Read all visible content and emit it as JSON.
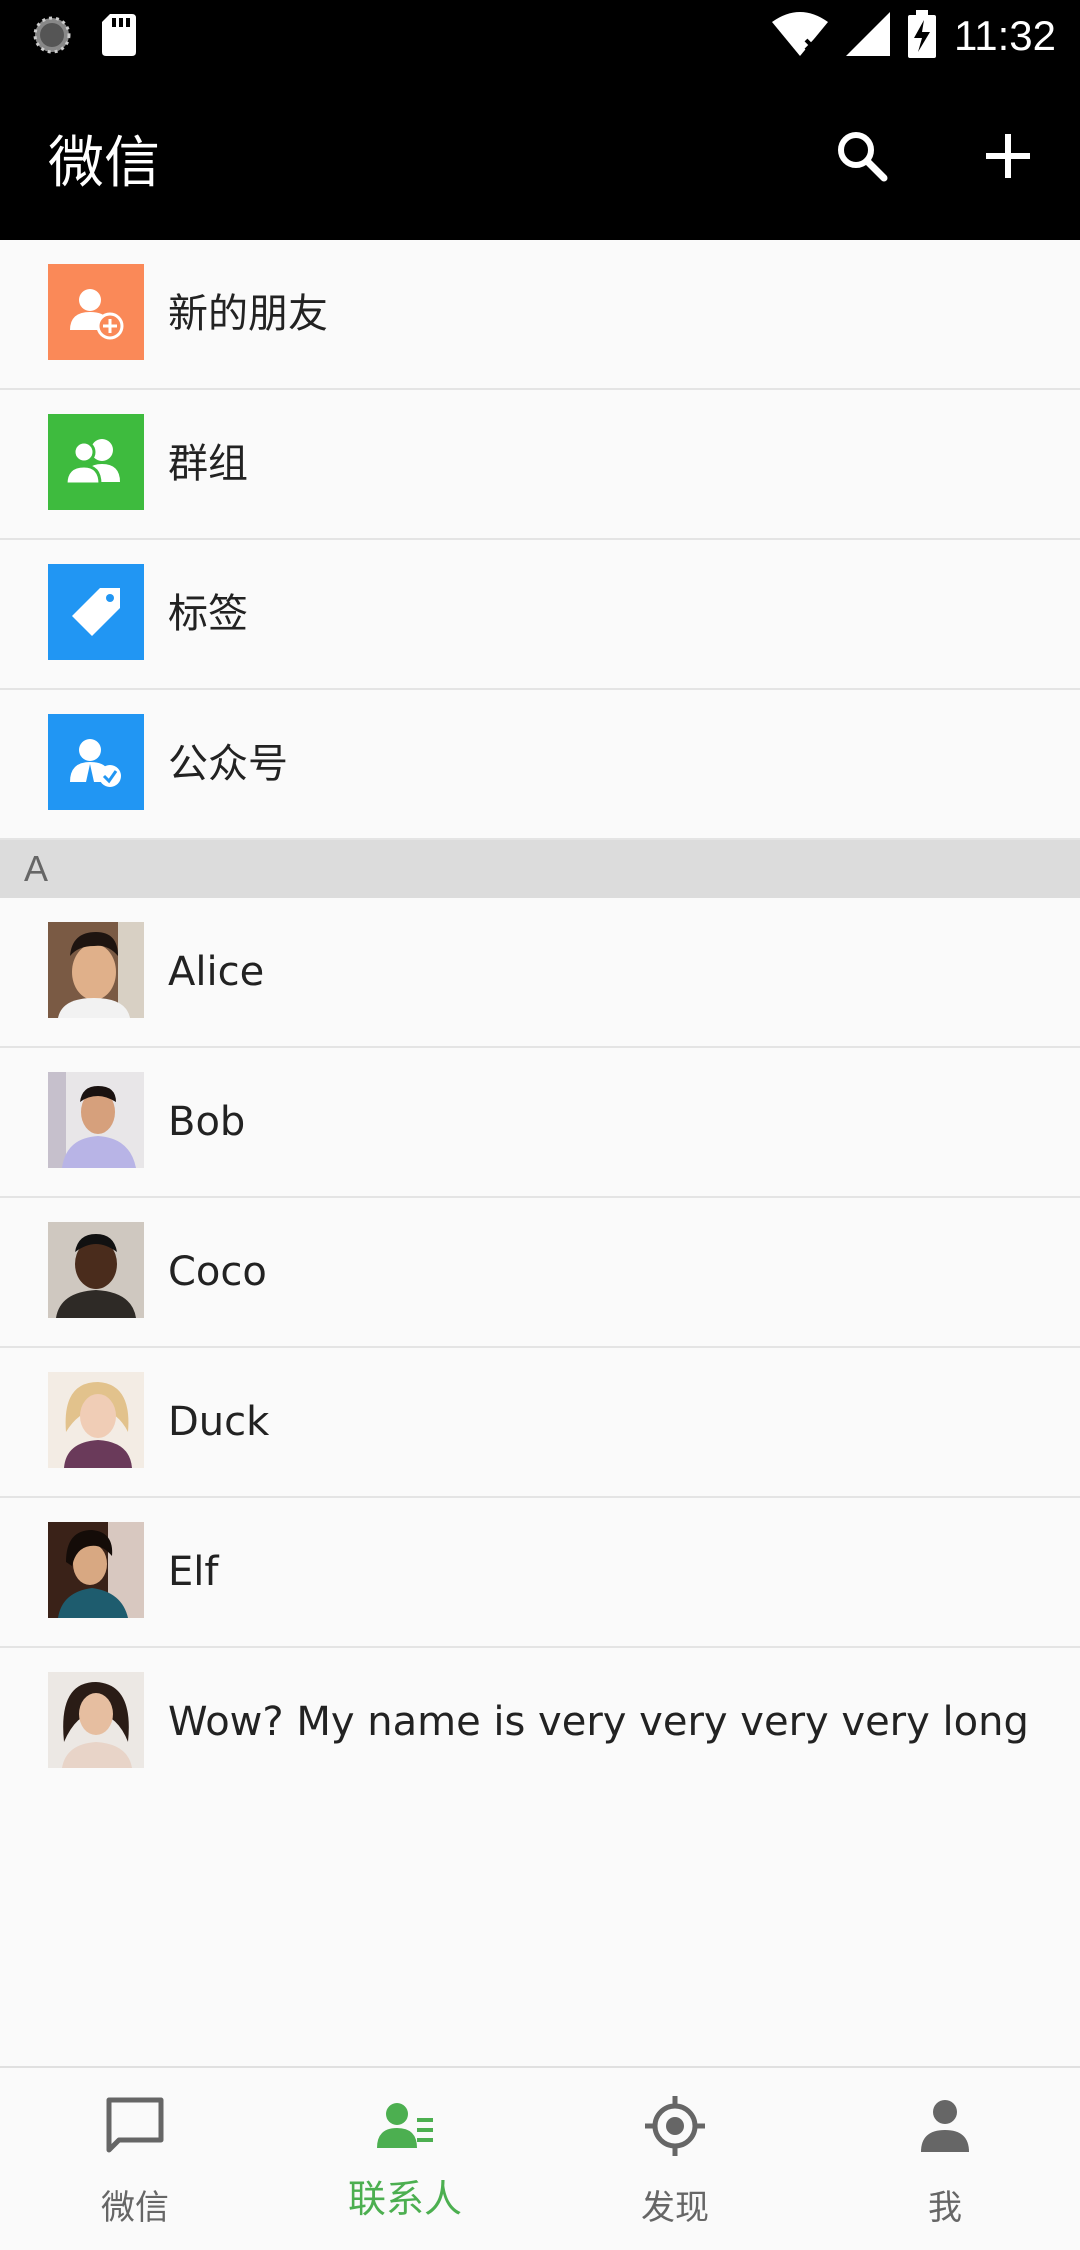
{
  "status_bar": {
    "time": "11:32"
  },
  "app_bar": {
    "title": "微信"
  },
  "menu_items": [
    {
      "label": "新的朋友",
      "icon": "add-friend-icon",
      "color": "#fa8958"
    },
    {
      "label": "群组",
      "icon": "group-icon",
      "color": "#3ebb3e"
    },
    {
      "label": "标签",
      "icon": "tag-icon",
      "color": "#2196f3"
    },
    {
      "label": "公众号",
      "icon": "official-account-icon",
      "color": "#2196f3"
    }
  ],
  "section": {
    "letter": "A"
  },
  "contacts": [
    {
      "name": "Alice"
    },
    {
      "name": "Bob"
    },
    {
      "name": "Coco"
    },
    {
      "name": "Duck"
    },
    {
      "name": "Elf"
    },
    {
      "name": "Wow? My name is very very very very long"
    }
  ],
  "bottom_nav": [
    {
      "label": "微信",
      "icon": "chat-icon",
      "active": false
    },
    {
      "label": "联系人",
      "icon": "contacts-icon",
      "active": true
    },
    {
      "label": "发现",
      "icon": "discover-icon",
      "active": false
    },
    {
      "label": "我",
      "icon": "profile-icon",
      "active": false
    }
  ],
  "colors": {
    "accent": "#4caf50",
    "app_bar": "#000000",
    "inactive": "#666666"
  }
}
